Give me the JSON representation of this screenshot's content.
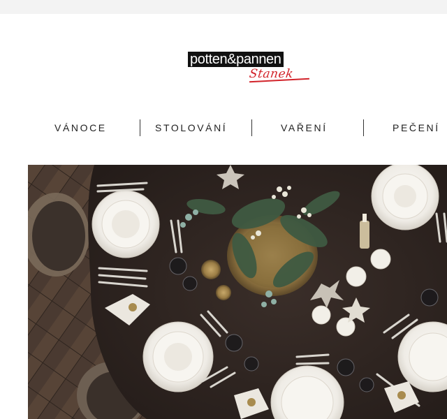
{
  "brand": {
    "name": "potten&pannen",
    "sub": "Stanek"
  },
  "nav": {
    "items": [
      "VÁNOCE",
      "STOLOVÁNÍ",
      "VAŘENÍ",
      "PEČENÍ"
    ]
  },
  "colors": {
    "brand_red": "#d2232a",
    "table": "#2f2521",
    "plate": "#f3f1ec"
  },
  "hero": {
    "icon": "christmas-table-setting-image"
  }
}
